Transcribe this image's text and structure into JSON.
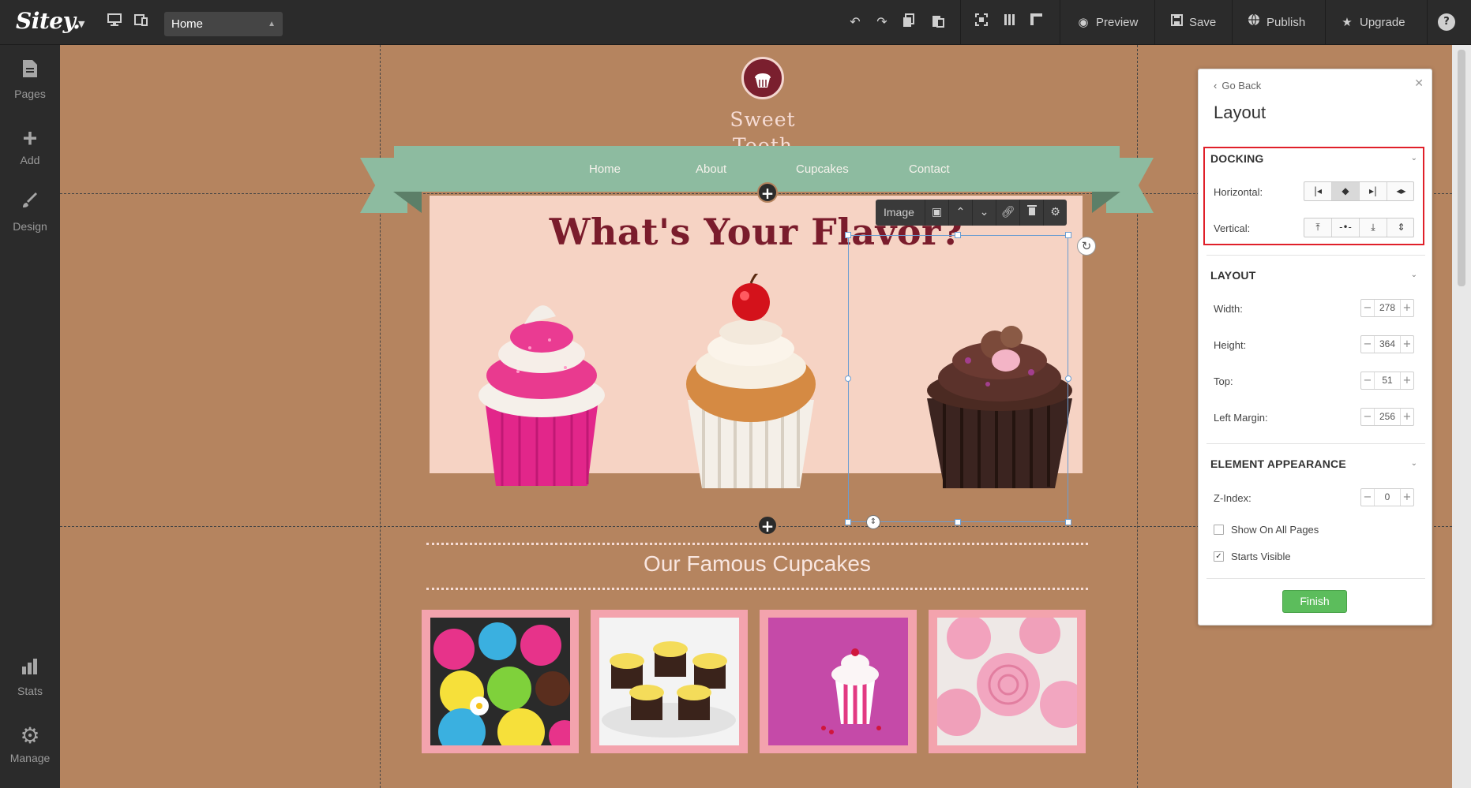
{
  "app": {
    "brand": "Sitey."
  },
  "topbar": {
    "page_select": "Home",
    "preview_label": "Preview",
    "save_label": "Save",
    "publish_label": "Publish",
    "upgrade_label": "Upgrade",
    "help_label": "?"
  },
  "sidebar": {
    "items": [
      {
        "label": "Pages",
        "icon": "pages-icon"
      },
      {
        "label": "Add",
        "icon": "plus-icon"
      },
      {
        "label": "Design",
        "icon": "brush-icon"
      },
      {
        "label": "Stats",
        "icon": "stats-icon"
      },
      {
        "label": "Manage",
        "icon": "gear-icon"
      }
    ]
  },
  "site": {
    "logo_text_line1": "Sweet",
    "logo_text_line2": "Tooth",
    "nav": [
      "Home",
      "About",
      "Cupcakes",
      "Contact"
    ],
    "hero_title": "What's Your Flavor?",
    "section_title": "Our Famous Cupcakes"
  },
  "image_toolbar": {
    "label": "Image"
  },
  "layout_panel": {
    "go_back": "Go Back",
    "title": "Layout",
    "docking": {
      "heading": "DOCKING",
      "horizontal_label": "Horizontal:",
      "vertical_label": "Vertical:"
    },
    "layout": {
      "heading": "LAYOUT",
      "width_label": "Width:",
      "width": "278",
      "height_label": "Height:",
      "height": "364",
      "top_label": "Top:",
      "top": "51",
      "left_margin_label": "Left Margin:",
      "left_margin": "256"
    },
    "appearance": {
      "heading": "ELEMENT APPEARANCE",
      "zindex_label": "Z-Index:",
      "zindex": "0",
      "show_all_pages": "Show On All Pages",
      "starts_visible": "Starts Visible"
    },
    "finish_label": "Finish"
  },
  "colors": {
    "canvas_bg": "#b5845f",
    "hero_bg": "#f6d3c4",
    "ribbon": "#8dbba0",
    "title_color": "#7a1c2c",
    "finish_green": "#5cbd5c",
    "highlight_red": "#e0202a"
  }
}
